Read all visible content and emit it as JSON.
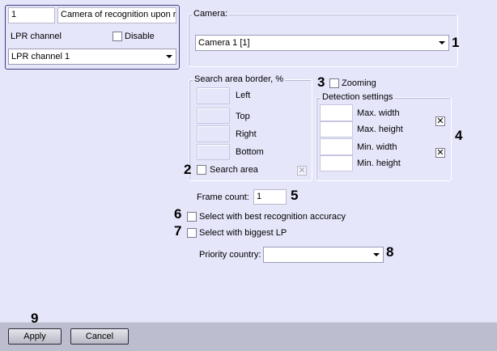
{
  "left_panel": {
    "id_value": "1",
    "name_value": "Camera of recognition upon re",
    "lpr_channel_label": "LPR channel",
    "disable_label": "Disable",
    "lpr_channel_selected": "LPR channel 1"
  },
  "camera": {
    "title": "Camera:",
    "selected": "Camera 1 [1]"
  },
  "search_area": {
    "title": "Search area border, %",
    "left_label": "Left",
    "top_label": "Top",
    "right_label": "Right",
    "bottom_label": "Bottom",
    "search_area_label": "Search area"
  },
  "zooming_label": "Zooming",
  "detection": {
    "title": "Detection settings",
    "max_width_label": "Max. width",
    "max_height_label": "Max. height",
    "min_width_label": "Min. width",
    "min_height_label": "Min. height"
  },
  "frame_count": {
    "label": "Frame count:",
    "value": "1"
  },
  "best_accuracy_label": "Select with best recognition accuracy",
  "biggest_lp_label": "Select with biggest LP",
  "priority_country": {
    "label": "Priority country:",
    "selected": ""
  },
  "buttons": {
    "apply": "Apply",
    "cancel": "Cancel"
  },
  "callouts": [
    "1",
    "2",
    "3",
    "4",
    "5",
    "6",
    "7",
    "8",
    "9"
  ]
}
